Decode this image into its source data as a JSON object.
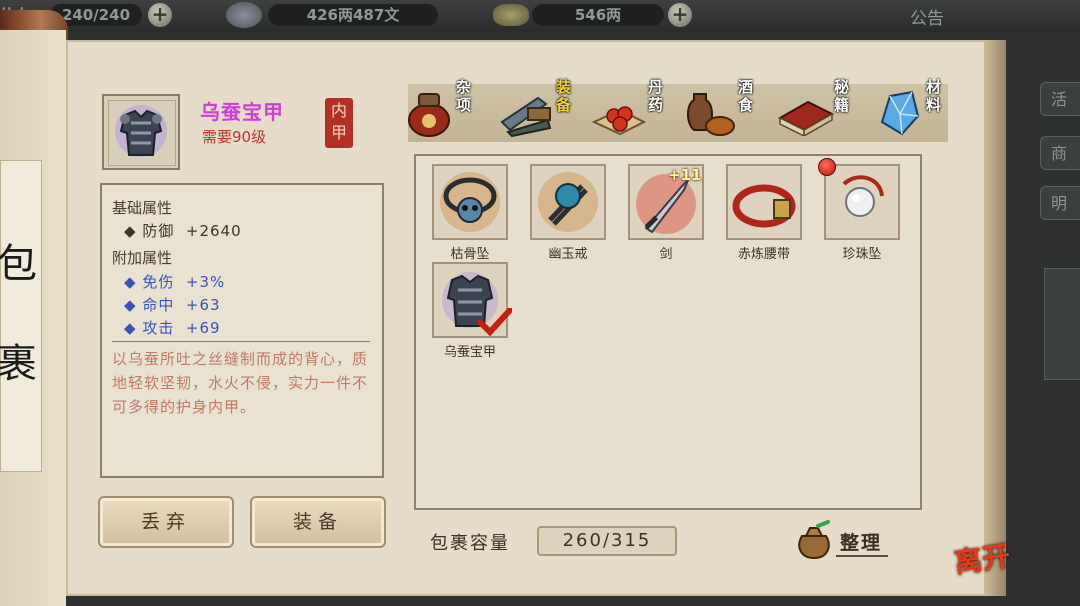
{
  "topbar": {
    "stamina_label": "体力",
    "stamina": "240/240",
    "silver": "426两487文",
    "gold": "546两",
    "notice": "公告"
  },
  "right_menu": [
    "活",
    "商",
    "明"
  ],
  "left_scroll": {
    "chars": [
      "包",
      "裹"
    ]
  },
  "item": {
    "name": "乌蚕宝甲",
    "requirement": "需要90级",
    "slot_type": "内甲",
    "icon": "armor-icon",
    "name_color": "#d23cd9",
    "base_title": "基础属性",
    "base": [
      {
        "name": "防御",
        "value": "+2640"
      }
    ],
    "extra_title": "附加属性",
    "extra": [
      {
        "name": "免伤",
        "value": "+3%"
      },
      {
        "name": "命中",
        "value": "+63"
      },
      {
        "name": "攻击",
        "value": "+69"
      }
    ],
    "description": "以乌蚕所吐之丝缝制而成的背心，质地轻软坚韧，水火不侵，实力一件不可多得的护身内甲。"
  },
  "buttons": {
    "discard": "丢弃",
    "equip": "装备"
  },
  "tabs": [
    {
      "label": "杂项",
      "icon": "jar-icon",
      "active": false
    },
    {
      "label": "装备",
      "icon": "weapon-bundle-icon",
      "active": true
    },
    {
      "label": "丹药",
      "icon": "pills-icon",
      "active": false
    },
    {
      "label": "酒食",
      "icon": "wine-food-icon",
      "active": false
    },
    {
      "label": "秘籍",
      "icon": "book-icon",
      "active": false
    },
    {
      "label": "材料",
      "icon": "crystal-icon",
      "active": false
    }
  ],
  "inventory": [
    {
      "name": "枯骨坠",
      "icon": "skull-pendant-icon",
      "badge": "",
      "equipped": false,
      "new": false
    },
    {
      "name": "幽玉戒",
      "icon": "ring-icon",
      "badge": "",
      "equipped": false,
      "new": false
    },
    {
      "name": "剑",
      "icon": "sword-icon",
      "badge": "+11",
      "equipped": false,
      "new": false
    },
    {
      "name": "赤炼腰带",
      "icon": "belt-icon",
      "badge": "",
      "equipped": false,
      "new": false
    },
    {
      "name": "珍珠坠",
      "icon": "pearl-pendant-icon",
      "badge": "",
      "equipped": false,
      "new": true
    },
    {
      "name": "乌蚕宝甲",
      "icon": "armor-icon",
      "badge": "",
      "equipped": true,
      "new": false
    }
  ],
  "capacity": {
    "label": "包裹容量",
    "value": "260/315"
  },
  "sort_label": "整理",
  "leave_label": "离开",
  "colors": {
    "extra_attr": "#3a52c0",
    "base_attr": "#3d3326",
    "description": "#c07a66",
    "active_tab": "#f2d23c"
  }
}
